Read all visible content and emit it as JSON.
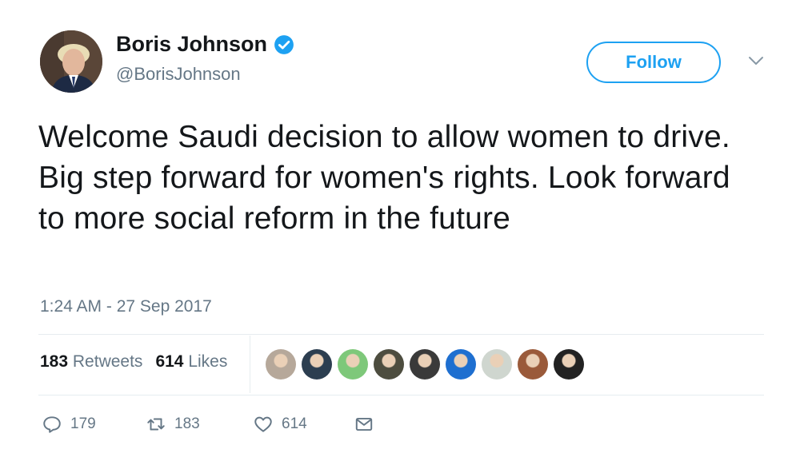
{
  "author": {
    "name": "Boris Johnson",
    "handle": "@BorisJohnson",
    "verified_icon": "verified-badge-icon",
    "avatar_icon": "profile-avatar"
  },
  "follow_button": {
    "label": "Follow"
  },
  "menu_icon": "chevron-down-icon",
  "tweet": {
    "text": "Welcome Saudi decision to allow women to drive. Big step forward for women's rights. Look forward to more social reform in the future",
    "timestamp": "1:24 AM - 27 Sep 2017"
  },
  "stats": {
    "retweets_count": "183",
    "retweets_label": "Retweets",
    "likes_count": "614",
    "likes_label": "Likes"
  },
  "likers": [
    {
      "color": "#b6a89a"
    },
    {
      "color": "#2c3e50"
    },
    {
      "color": "#7ec87a"
    },
    {
      "color": "#4d4d3f"
    },
    {
      "color": "#3a3a3a"
    },
    {
      "color": "#1e6fd0"
    },
    {
      "color": "#cfd6cf"
    },
    {
      "color": "#9a5a3a"
    },
    {
      "color": "#222222"
    }
  ],
  "actions": {
    "reply_count": "179",
    "retweet_count": "183",
    "like_count": "614"
  },
  "colors": {
    "accent": "#1da1f2",
    "text": "#14171a",
    "muted": "#657786",
    "divider": "#e6ecf0"
  }
}
